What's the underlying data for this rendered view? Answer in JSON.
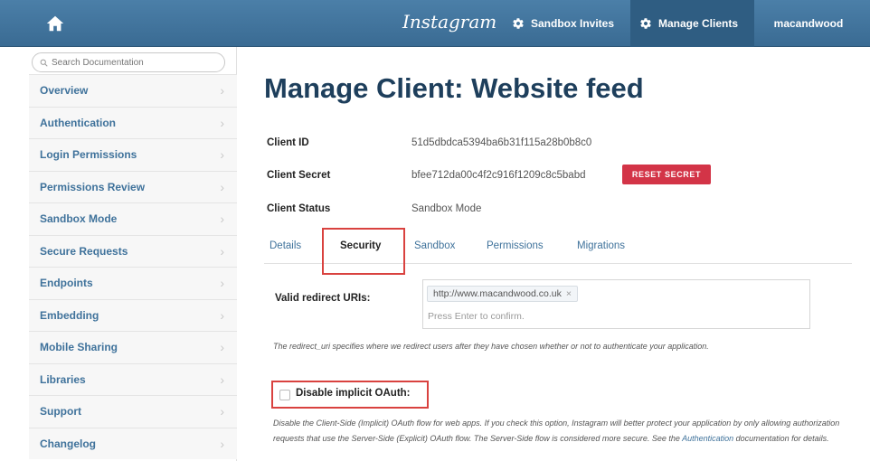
{
  "topbar": {
    "brand": "Instagram",
    "nav": [
      {
        "label": "Sandbox Invites",
        "icon": "gear-icon"
      },
      {
        "label": "Manage Clients",
        "icon": "gear-icon"
      },
      {
        "label": "macandwood"
      }
    ]
  },
  "sidebar": {
    "search_placeholder": "Search Documentation",
    "items": [
      {
        "label": "Overview"
      },
      {
        "label": "Authentication"
      },
      {
        "label": "Login Permissions"
      },
      {
        "label": "Permissions Review"
      },
      {
        "label": "Sandbox Mode"
      },
      {
        "label": "Secure Requests"
      },
      {
        "label": "Endpoints"
      },
      {
        "label": "Embedding"
      },
      {
        "label": "Mobile Sharing"
      },
      {
        "label": "Libraries"
      },
      {
        "label": "Support"
      },
      {
        "label": "Changelog"
      }
    ],
    "chevron": "›"
  },
  "main": {
    "title": "Manage Client: Website feed",
    "client_id": {
      "label": "Client ID",
      "value": "51d5dbdca5394ba6b31f115a28b0b8c0"
    },
    "client_secret": {
      "label": "Client Secret",
      "value": "bfee712da00c4f2c916f1209c8c5babd",
      "button": "RESET SECRET"
    },
    "client_status": {
      "label": "Client Status",
      "value": "Sandbox Mode"
    },
    "tabs": [
      {
        "label": "Details"
      },
      {
        "label": "Security"
      },
      {
        "label": "Sandbox"
      },
      {
        "label": "Permissions"
      },
      {
        "label": "Migrations"
      }
    ],
    "redirect": {
      "label": "Valid redirect URIs:",
      "uri": "http://www.macandwood.co.uk",
      "remove": "×",
      "hint": "Press Enter to confirm.",
      "description": "The redirect_uri specifies where we redirect users after they have chosen whether or not to authenticate your application."
    },
    "implicit": {
      "label": "Disable implicit OAuth:",
      "description_pre": "Disable the Client-Side (Implicit) OAuth flow for web apps. If you check this option, Instagram will better protect your application by only allowing authorization requests that use the Server-Side (Explicit) OAuth flow. The Server-Side flow is considered more secure. See the ",
      "description_link": "Authentication",
      "description_post": " documentation for details."
    }
  },
  "colors": {
    "topbar": "#3f729b",
    "link": "#3f729b",
    "reset_button": "#d33447",
    "highlight_box": "#d9423f"
  }
}
